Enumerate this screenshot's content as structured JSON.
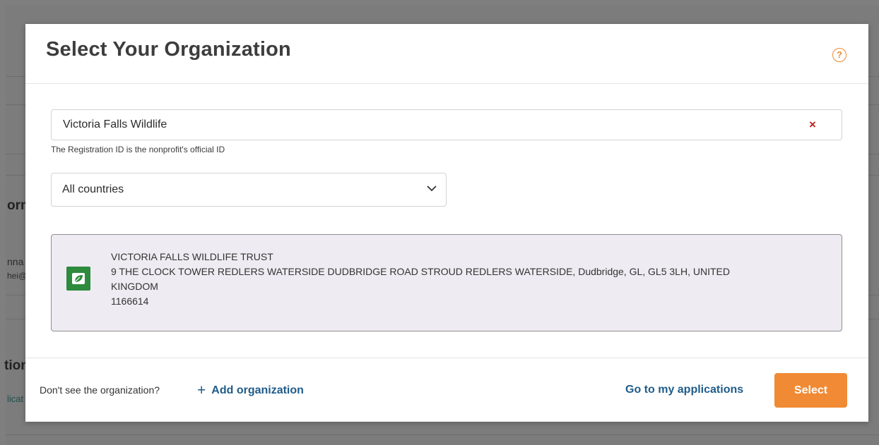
{
  "background": {
    "fragments": [
      "orm",
      "nna",
      "hei@",
      "tion",
      "licat"
    ]
  },
  "modal": {
    "title": "Select Your Organization",
    "help_icon": "?"
  },
  "search": {
    "value": "Victoria Falls Wildlife",
    "clear_icon": "×",
    "help_text": "The Registration ID is the nonprofit's official ID"
  },
  "country_filter": {
    "selected": "All countries"
  },
  "result": {
    "name": "VICTORIA FALLS WILDLIFE TRUST",
    "address_line1": "9 THE CLOCK TOWER REDLERS WATERSIDE DUDBRIDGE ROAD STROUD REDLERS WATERSIDE, Dudbridge, GL, GL5 3LH, UNITED",
    "address_line2": "KINGDOM",
    "registration_id": "1166614"
  },
  "footer": {
    "question": "Don't see the organization?",
    "add_org_icon": "+",
    "add_org_label": "Add organization",
    "go_apps_label": "Go to my applications",
    "select_label": "Select"
  },
  "colors": {
    "accent": "#f08a34",
    "link": "#1f5c8a",
    "logo_green": "#2e8a3d"
  }
}
